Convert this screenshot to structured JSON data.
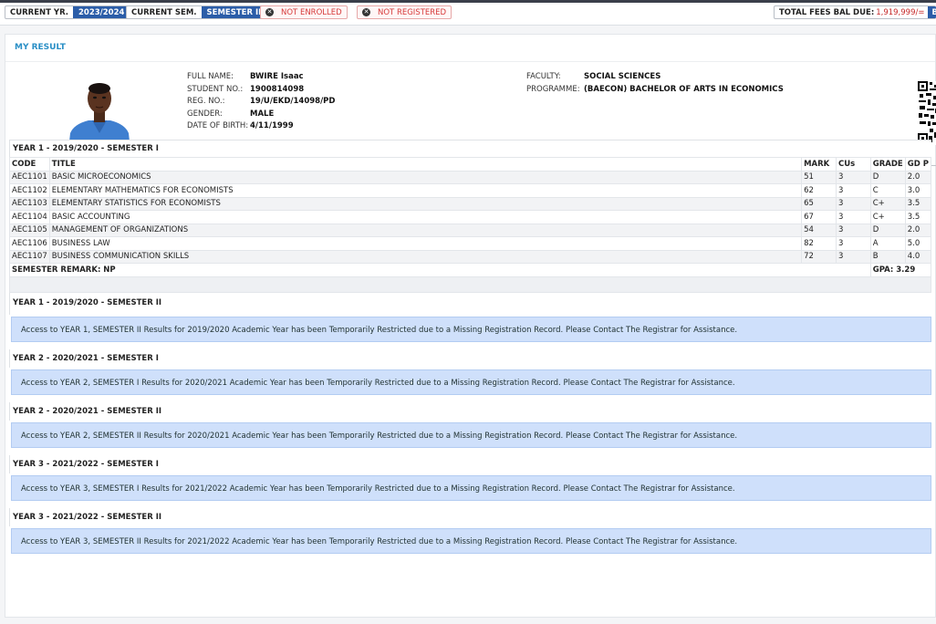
{
  "status_bar": {
    "current_year_label": "CURRENT YR.",
    "current_year_value": "2023/2024",
    "current_sem_label": "CURRENT SEM.",
    "current_sem_value": "SEMESTER II",
    "enrollment_status": "NOT ENROLLED",
    "registration_status": "NOT REGISTERED",
    "fees_label": "TOTAL FEES BAL DUE:",
    "fees_value": "1,919,999/=",
    "balance_button": "BAL"
  },
  "panel": {
    "title": "MY RESULT"
  },
  "student": {
    "labels": {
      "full_name": "FULL NAME:",
      "student_no": "STUDENT NO.:",
      "reg_no": "REG. NO.:",
      "gender": "GENDER:",
      "dob": "DATE OF BIRTH:",
      "faculty": "FACULTY:",
      "programme": "PROGRAMME:"
    },
    "full_name": "BWIRE Isaac",
    "student_no": "1900814098",
    "reg_no": "19/U/EKD/14098/PD",
    "gender": "MALE",
    "dob": "4/11/1999",
    "faculty": "SOCIAL SCIENCES",
    "programme": "(BAECON) BACHELOR OF ARTS IN ECONOMICS"
  },
  "colors": {
    "accent": "#2b5da8",
    "title_blue": "#2a8fc6",
    "alert_bg": "#cfe0fb",
    "danger": "#c62828"
  },
  "results": {
    "sem1": {
      "heading": "YEAR 1 - 2019/2020 - SEMESTER I",
      "columns": [
        "CODE",
        "TITLE",
        "MARK",
        "CUs",
        "GRADE",
        "GD P"
      ],
      "rows": [
        [
          "AEC1101",
          "BASIC MICROECONOMICS",
          "51",
          "3",
          "D",
          "2.0"
        ],
        [
          "AEC1102",
          "ELEMENTARY MATHEMATICS FOR ECONOMISTS",
          "62",
          "3",
          "C",
          "3.0"
        ],
        [
          "AEC1103",
          "ELEMENTARY STATISTICS FOR ECONOMISTS",
          "65",
          "3",
          "C+",
          "3.5"
        ],
        [
          "AEC1104",
          "BASIC ACCOUNTING",
          "67",
          "3",
          "C+",
          "3.5"
        ],
        [
          "AEC1105",
          "MANAGEMENT OF ORGANIZATIONS",
          "54",
          "3",
          "D",
          "2.0"
        ],
        [
          "AEC1106",
          "BUSINESS LAW",
          "82",
          "3",
          "A",
          "5.0"
        ],
        [
          "AEC1107",
          "BUSINESS COMMUNICATION SKILLS",
          "72",
          "3",
          "B",
          "4.0"
        ]
      ],
      "remark": "SEMESTER REMARK: NP",
      "gpa": "GPA: 3.29"
    },
    "restricted": [
      {
        "heading": "YEAR 1 - 2019/2020 - SEMESTER II",
        "message": "Access to YEAR 1, SEMESTER II Results for 2019/2020 Academic Year has been Temporarily Restricted due to a Missing Registration Record. Please Contact The Registrar for Assistance."
      },
      {
        "heading": "YEAR 2 - 2020/2021 - SEMESTER I",
        "message": "Access to YEAR 2, SEMESTER I Results for 2020/2021 Academic Year has been Temporarily Restricted due to a Missing Registration Record. Please Contact The Registrar for Assistance."
      },
      {
        "heading": "YEAR 2 - 2020/2021 - SEMESTER II",
        "message": "Access to YEAR 2, SEMESTER II Results for 2020/2021 Academic Year has been Temporarily Restricted due to a Missing Registration Record. Please Contact The Registrar for Assistance."
      },
      {
        "heading": "YEAR 3 - 2021/2022 - SEMESTER I",
        "message": "Access to YEAR 3, SEMESTER I Results for 2021/2022 Academic Year has been Temporarily Restricted due to a Missing Registration Record. Please Contact The Registrar for Assistance."
      },
      {
        "heading": "YEAR 3 - 2021/2022 - SEMESTER II",
        "message": "Access to YEAR 3, SEMESTER II Results for 2021/2022 Academic Year has been Temporarily Restricted due to a Missing Registration Record. Please Contact The Registrar for Assistance."
      }
    ]
  }
}
